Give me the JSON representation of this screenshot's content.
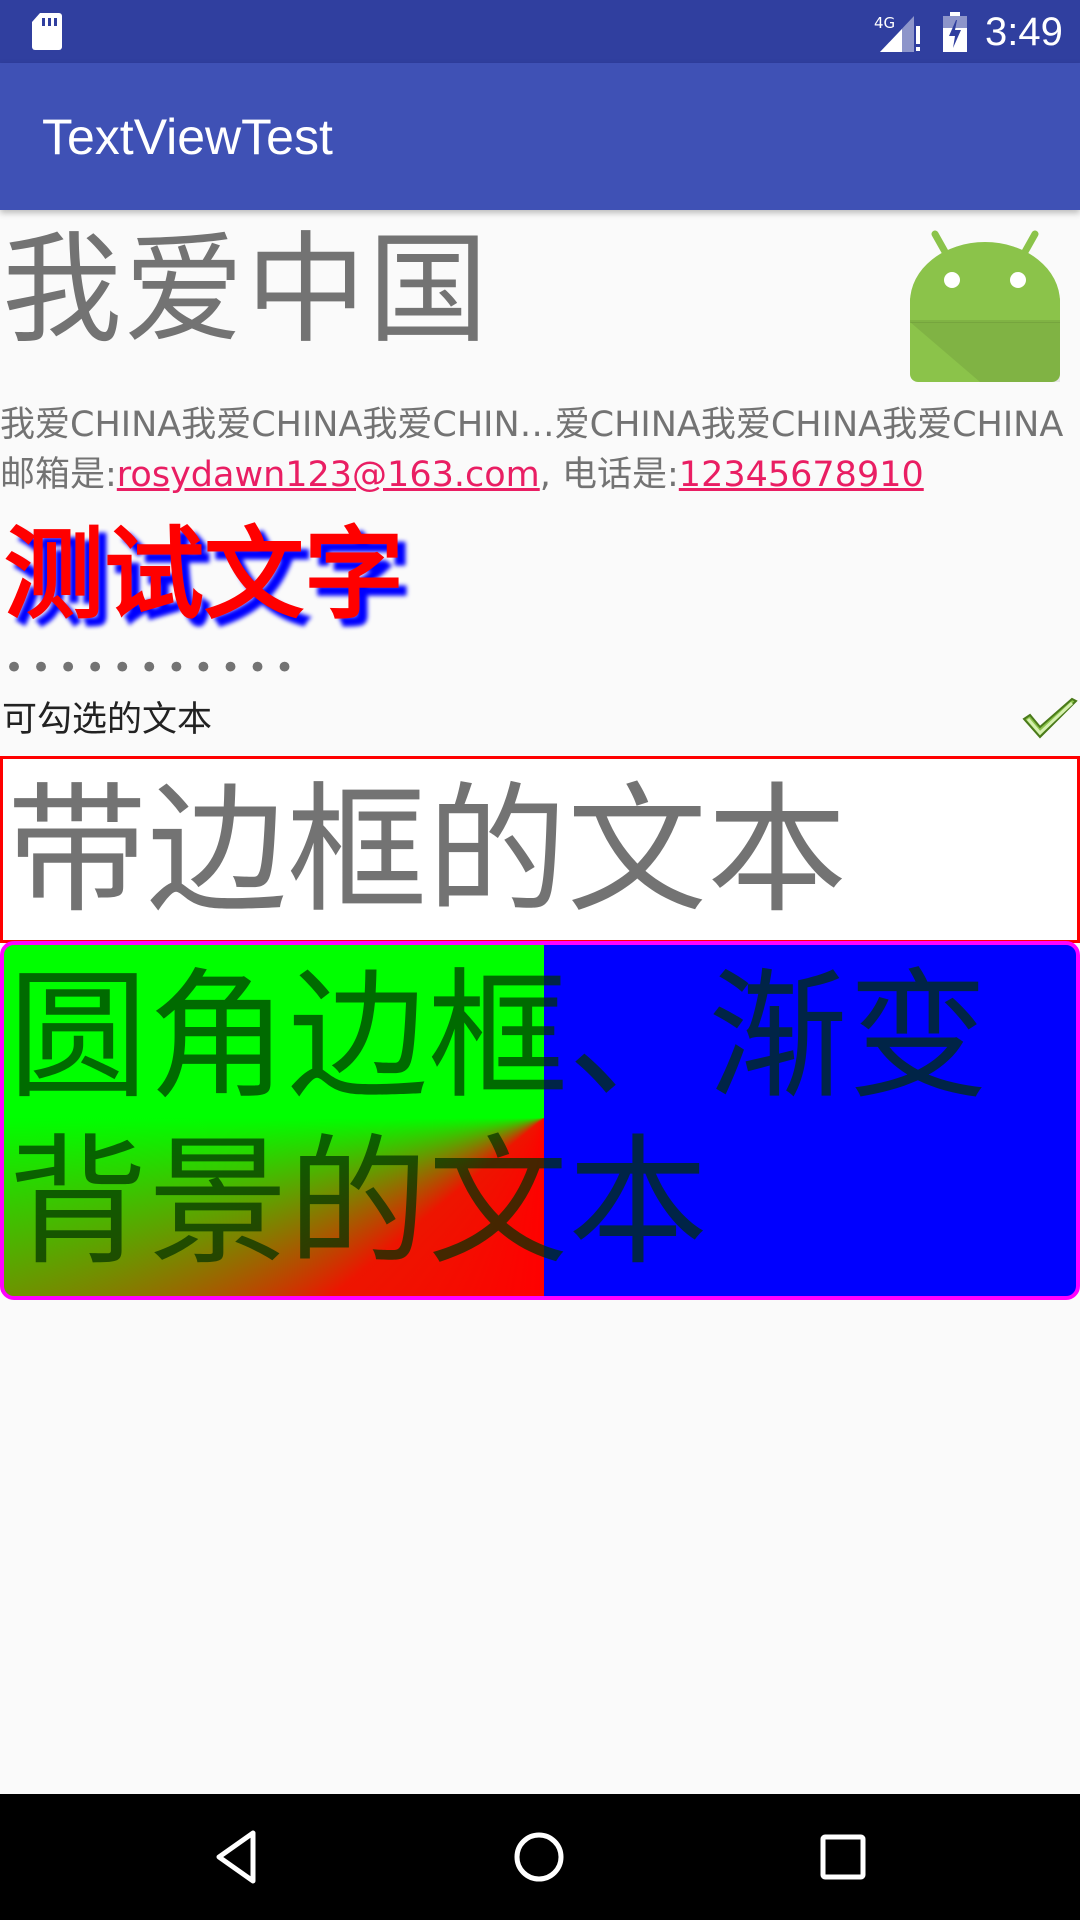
{
  "status_bar": {
    "time": "3:49",
    "network_label": "4G",
    "icons": [
      "sd-card-icon",
      "signal-icon",
      "battery-icon"
    ]
  },
  "app_bar": {
    "title": "TextViewTest",
    "color": "#3f51b5"
  },
  "content": {
    "big_heading": "我爱中国",
    "android_logo": "android-logo",
    "ellipsized_text": "我爱CHINA我爱CHINA我爱CHIN…爱CHINA我爱CHINA我爱CHINA",
    "contact": {
      "email_label": "邮箱是:",
      "email": "rosydawn123@163.com",
      "phone_label": ", 电话是:",
      "phone": "12345678910"
    },
    "shadow_text": "测试文字",
    "password_dots": "•••••••••••",
    "checked_text": "可勾选的文本",
    "bordered_text": "带边框的文本",
    "gradient_text": "圆角边框、渐变背景的文本"
  },
  "nav_bar": {
    "icons": [
      "back-icon",
      "home-icon",
      "recents-icon"
    ]
  },
  "colors": {
    "status_bar": "#303f9f",
    "link": "#e91e63",
    "shadow_text": "#ff0000",
    "shadow_color": "#0000ff",
    "border": "#ff0000",
    "rounded_border": "#ff00ff"
  }
}
